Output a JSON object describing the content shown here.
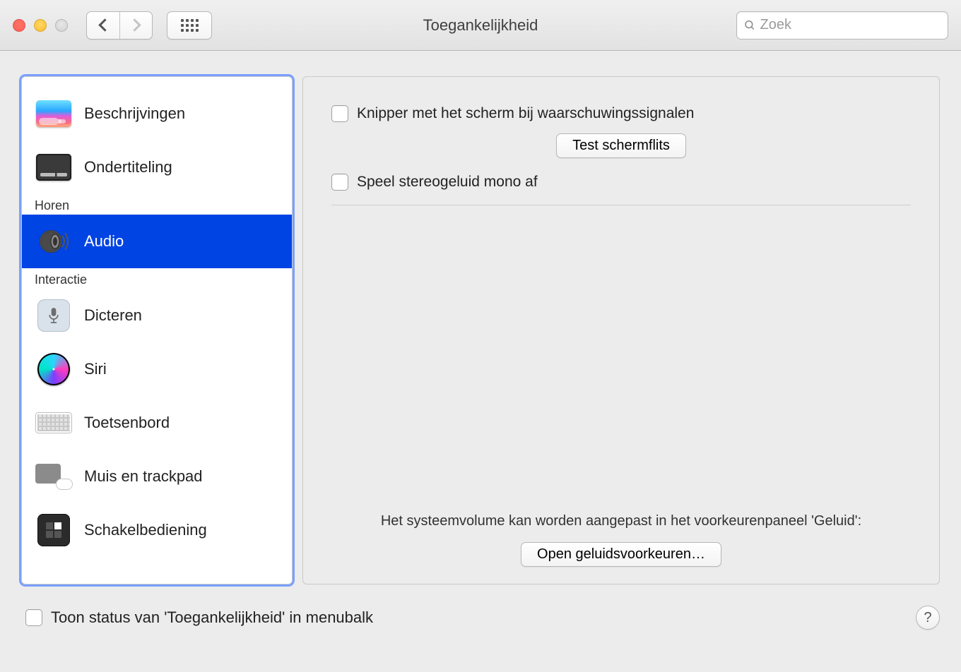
{
  "window": {
    "title": "Toegankelijkheid",
    "search_placeholder": "Zoek"
  },
  "sidebar": {
    "items": [
      {
        "label": "Beschrijvingen"
      },
      {
        "label": "Ondertiteling"
      }
    ],
    "group_hearing": "Horen",
    "audio_item": {
      "label": "Audio"
    },
    "group_interaction": "Interactie",
    "interaction_items": [
      {
        "label": "Dicteren"
      },
      {
        "label": "Siri"
      },
      {
        "label": "Toetsenbord"
      },
      {
        "label": "Muis en trackpad"
      },
      {
        "label": "Schakelbediening"
      }
    ]
  },
  "pane": {
    "flash_label": "Knipper met het scherm bij waarschuwingssignalen",
    "test_flash_btn": "Test schermflits",
    "mono_label": "Speel stereogeluid mono af",
    "volume_hint": "Het systeemvolume kan worden aangepast in het voorkeurenpaneel 'Geluid':",
    "open_sound_btn": "Open geluidsvoorkeuren…"
  },
  "footer": {
    "menubar_status_label": "Toon status van 'Toegankelijkheid' in menubalk"
  }
}
